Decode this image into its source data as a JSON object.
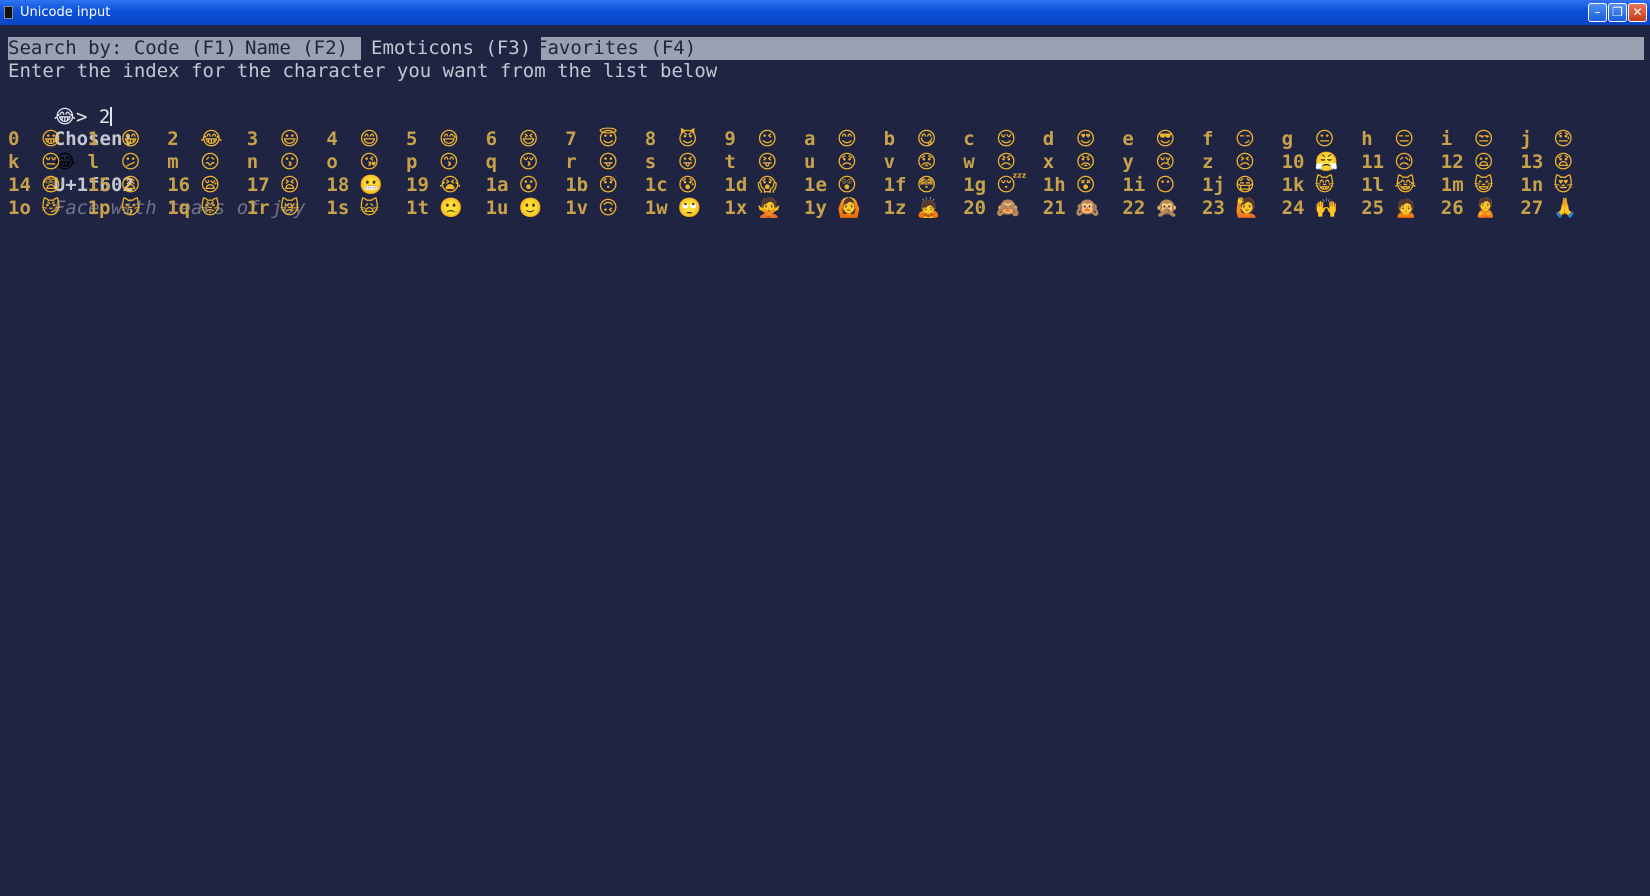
{
  "window": {
    "title": "Unicode input",
    "min_glyph": "–",
    "max_glyph": "❐",
    "close_glyph": "✕"
  },
  "tabs": [
    {
      "label": "Search by: Code (F1)",
      "active": false
    },
    {
      "label": "Name (F2)",
      "active": false
    },
    {
      "label": "Emoticons (F3)",
      "active": true
    },
    {
      "label": "Favorites (F4)",
      "active": false
    }
  ],
  "instruction": "Enter the index for the character you want from the list below",
  "prompt": {
    "emoji": "😂",
    "symbol": "> ",
    "value": "2"
  },
  "chosen": {
    "label": "Chosen:",
    "emoji": "😂",
    "code": "U+1f602",
    "name": "Face with tears of joy"
  },
  "grid": [
    [
      [
        "0",
        "😀"
      ],
      [
        "1",
        "😁"
      ],
      [
        "2",
        "😂"
      ],
      [
        "3",
        "😃"
      ],
      [
        "4",
        "😄"
      ],
      [
        "5",
        "😅"
      ],
      [
        "6",
        "😆"
      ],
      [
        "7",
        "😇"
      ],
      [
        "8",
        "😈"
      ],
      [
        "9",
        "😉"
      ],
      [
        "a",
        "😊"
      ],
      [
        "b",
        "😋"
      ],
      [
        "c",
        "😌"
      ],
      [
        "d",
        "😍"
      ],
      [
        "e",
        "😎"
      ],
      [
        "f",
        "😏"
      ],
      [
        "g",
        "😐"
      ],
      [
        "h",
        "😑"
      ],
      [
        "i",
        "😒"
      ],
      [
        "j",
        "😓"
      ]
    ],
    [
      [
        "k",
        "😔"
      ],
      [
        "l",
        "😕"
      ],
      [
        "m",
        "😖"
      ],
      [
        "n",
        "😗"
      ],
      [
        "o",
        "😘"
      ],
      [
        "p",
        "😙"
      ],
      [
        "q",
        "😚"
      ],
      [
        "r",
        "😛"
      ],
      [
        "s",
        "😜"
      ],
      [
        "t",
        "😝"
      ],
      [
        "u",
        "😞"
      ],
      [
        "v",
        "😟"
      ],
      [
        "w",
        "😠"
      ],
      [
        "x",
        "😡"
      ],
      [
        "y",
        "😢"
      ],
      [
        "z",
        "😣"
      ],
      [
        "10",
        "😤"
      ],
      [
        "11",
        "😥"
      ],
      [
        "12",
        "😦"
      ],
      [
        "13",
        "😧"
      ]
    ],
    [
      [
        "14",
        "😨"
      ],
      [
        "15",
        "😩"
      ],
      [
        "16",
        "😪"
      ],
      [
        "17",
        "😫"
      ],
      [
        "18",
        "😬"
      ],
      [
        "19",
        "😭"
      ],
      [
        "1a",
        "😮"
      ],
      [
        "1b",
        "😯"
      ],
      [
        "1c",
        "😰"
      ],
      [
        "1d",
        "😱"
      ],
      [
        "1e",
        "😲"
      ],
      [
        "1f",
        "😳"
      ],
      [
        "1g",
        "😴"
      ],
      [
        "1h",
        "😵"
      ],
      [
        "1i",
        "😶"
      ],
      [
        "1j",
        "😷"
      ],
      [
        "1k",
        "😸"
      ],
      [
        "1l",
        "😹"
      ],
      [
        "1m",
        "😺"
      ],
      [
        "1n",
        "😻"
      ]
    ],
    [
      [
        "1o",
        "😼"
      ],
      [
        "1p",
        "😽"
      ],
      [
        "1q",
        "😾"
      ],
      [
        "1r",
        "😿"
      ],
      [
        "1s",
        "🙀"
      ],
      [
        "1t",
        "🙁"
      ],
      [
        "1u",
        "🙂"
      ],
      [
        "1v",
        "🙃"
      ],
      [
        "1w",
        "🙄"
      ],
      [
        "1x",
        "🙅"
      ],
      [
        "1y",
        "🙆"
      ],
      [
        "1z",
        "🙇"
      ],
      [
        "20",
        "🙈"
      ],
      [
        "21",
        "🙉"
      ],
      [
        "22",
        "🙊"
      ],
      [
        "23",
        "🙋"
      ],
      [
        "24",
        "🙌"
      ],
      [
        "25",
        "🙍"
      ],
      [
        "26",
        "🙎"
      ],
      [
        "27",
        "🙏"
      ]
    ]
  ]
}
